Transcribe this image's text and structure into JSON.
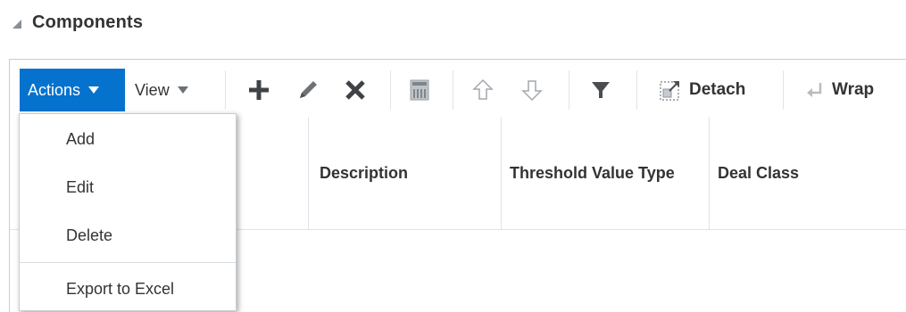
{
  "section": {
    "title": "Components",
    "collapse_icon": "triangle-collapse-icon"
  },
  "toolbar": {
    "actions_label": "Actions",
    "view_label": "View",
    "detach_label": "Detach",
    "wrap_label": "Wrap",
    "icons": [
      "add-icon",
      "edit-icon",
      "delete-icon",
      "freeze-icon",
      "move-up-icon",
      "move-down-icon",
      "filter-icon",
      "detach-icon",
      "wrap-icon"
    ],
    "accent": "#0572ce"
  },
  "table": {
    "columns": [
      "",
      "Description",
      "Threshold Value Type",
      "Deal Class"
    ]
  },
  "actions_menu": {
    "items": [
      "Add",
      "Edit",
      "Delete",
      "Export to Excel"
    ]
  }
}
